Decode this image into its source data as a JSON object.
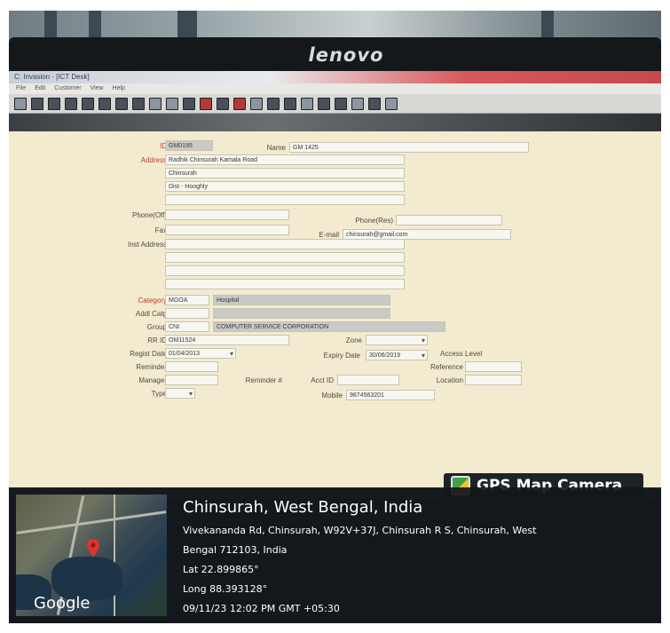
{
  "monitor": {
    "brand": "lenovo"
  },
  "window": {
    "title": "C: Invasion - [ICT Desk]",
    "menu": [
      "File",
      "Edit",
      "Customer",
      "View",
      "Help"
    ]
  },
  "form": {
    "id": {
      "label": "ID",
      "value": "GM0195"
    },
    "name": {
      "label": "Name",
      "value": "GM 1425"
    },
    "address": {
      "label": "Address",
      "lines": [
        "Radhik Chinsurah Kamala Road",
        "Chinsurah",
        "Dist - Hooghly"
      ]
    },
    "phone_off": {
      "label": "Phone(Off)",
      "value": ""
    },
    "phone_res": {
      "label": "Phone(Res)",
      "value": ""
    },
    "fax": {
      "label": "Fax",
      "value": ""
    },
    "email": {
      "label": "E-mail",
      "value": "chinsurah@gmail.com"
    },
    "inst_address": {
      "label": "Inst Address",
      "value": ""
    },
    "category": {
      "label": "Category",
      "code": "MGOA",
      "value": "Hospital"
    },
    "addl_catg": {
      "label": "Addl Catg",
      "value": ""
    },
    "group": {
      "label": "Group",
      "code": "CNI",
      "value": "COMPUTER SERVICE CORPORATION"
    },
    "rr_id": {
      "label": "RR ID",
      "value": "OM11524"
    },
    "zone": {
      "label": "Zone",
      "value": ""
    },
    "reg_date": {
      "label": "Regist Date",
      "value": "01/04/2013"
    },
    "expiry_date": {
      "label": "Expiry Date",
      "value": "30/06/2019"
    },
    "access_level": {
      "label": "Access Level",
      "value": ""
    },
    "reminder": {
      "label": "Reminder",
      "value": ""
    },
    "reference": {
      "label": "Reference",
      "value": ""
    },
    "manager": {
      "label": "Manager",
      "value": ""
    },
    "reminder2": {
      "label": "Reminder #",
      "value": ""
    },
    "acct_id": {
      "label": "Acct ID",
      "value": ""
    },
    "location": {
      "label": "Location",
      "value": ""
    },
    "type": {
      "label": "Type",
      "value": ""
    },
    "mobile": {
      "label": "Mobile",
      "value": "9874563201"
    }
  },
  "stamp": {
    "app": "GPS Map Camera",
    "map_label": "Google",
    "title": "Chinsurah, West Bengal, India",
    "address_line1": "Vivekananda Rd, Chinsurah, W92V+37J, Chinsurah R S, Chinsurah, West",
    "address_line2": "Bengal 712103, India",
    "lat": "Lat 22.899865°",
    "long": "Long 88.393128°",
    "datetime": "09/11/23 12:02 PM GMT +05:30"
  }
}
